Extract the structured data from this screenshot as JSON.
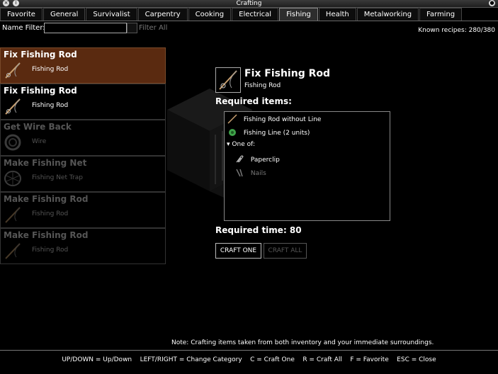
{
  "window": {
    "title": "Crafting"
  },
  "tabs": [
    {
      "label": "Favorite"
    },
    {
      "label": "General"
    },
    {
      "label": "Survivalist"
    },
    {
      "label": "Carpentry"
    },
    {
      "label": "Cooking"
    },
    {
      "label": "Electrical"
    },
    {
      "label": "Fishing"
    },
    {
      "label": "Health"
    },
    {
      "label": "Metalworking"
    },
    {
      "label": "Farming"
    }
  ],
  "active_tab": "Fishing",
  "filter": {
    "label": "Name Filter:",
    "value": "",
    "filter_all_label": "Filter All"
  },
  "known_recipes": "Known recipes: 280/380",
  "recipes": [
    {
      "name": "Fix Fishing Rod",
      "item": "Fishing Rod",
      "icon": "fishing-rod-icon"
    },
    {
      "name": "Fix Fishing Rod",
      "item": "Fishing Rod",
      "icon": "fishing-rod-icon"
    },
    {
      "name": "Get Wire Back",
      "item": "Wire",
      "icon": "wire-icon"
    },
    {
      "name": "Make Fishing Net",
      "item": "Fishing Net Trap",
      "icon": "fishing-net-icon"
    },
    {
      "name": "Make Fishing Rod",
      "item": "Fishing Rod",
      "icon": "fishing-rod-icon"
    },
    {
      "name": "Make Fishing Rod",
      "item": "Fishing Rod",
      "icon": "fishing-rod-icon"
    }
  ],
  "detail": {
    "title": "Fix Fishing Rod",
    "subtitle": "Fishing Rod",
    "required_items_label": "Required items:",
    "items": [
      {
        "label": "Fishing Rod without Line"
      },
      {
        "label": "Fishing Line (2 units)"
      }
    ],
    "one_of_label": "One of:",
    "one_of": [
      {
        "label": "Paperclip"
      },
      {
        "label": "Nails"
      }
    ],
    "required_time": "Required time: 80"
  },
  "buttons": {
    "craft_one": "CRAFT ONE",
    "craft_all": "CRAFT ALL"
  },
  "note": "Note: Crafting items taken from both inventory and your immediate surroundings.",
  "footer": "UP/DOWN = Up/Down    LEFT/RIGHT = Change Category    C = Craft One    R = Craft All    F = Favorite    ESC = Close",
  "colors": {
    "selected_bg": "#5a2a10",
    "background": "#000000"
  }
}
